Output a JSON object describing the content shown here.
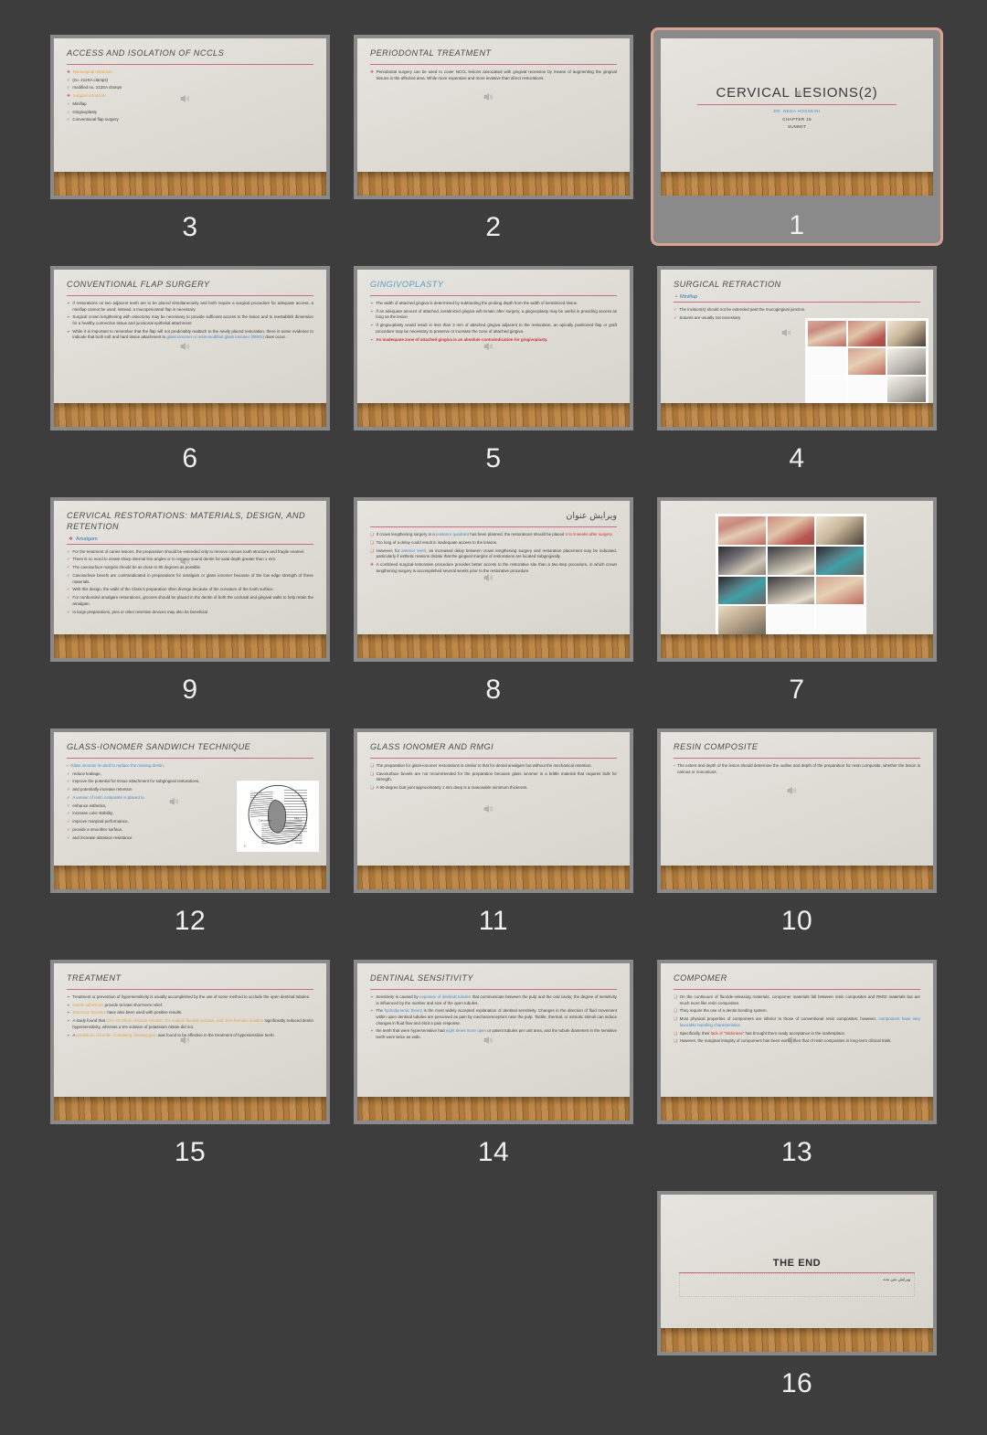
{
  "app": {
    "view": "slide-sorter",
    "background_color": "#3d3d3d",
    "selected_slide": 1,
    "accent_rule_color": "#d06a84",
    "selection_border_color": "#d9a38f",
    "speaker_icon": "audio-speaker-icon"
  },
  "slides": [
    {
      "number": "3",
      "title": "ACCESS AND ISOLATION OF NCCLS",
      "title_style": "italic",
      "has_audio": true,
      "bullets": [
        {
          "marker": "diamond",
          "text": "Nonsurgical retraction",
          "color": "orange"
        },
        {
          "marker": "check",
          "text": "(no. 212SA clamps)"
        },
        {
          "marker": "check",
          "text": "modified no. 212SA clamps"
        },
        {
          "marker": "diamond",
          "text": "Surgical retraction",
          "color": "orange"
        },
        {
          "marker": "check",
          "text": "Miniflap"
        },
        {
          "marker": "check",
          "text": "Gingivoplasty"
        },
        {
          "marker": "check",
          "text": "Conventional flap surgery"
        }
      ]
    },
    {
      "number": "2",
      "title": "PERIODONTAL TREATMENT",
      "title_style": "italic",
      "has_audio": true,
      "bullets": [
        {
          "marker": "diamond",
          "text": "Periodontal surgery can be used to cover NCCL lesions associated with gingival recession by means of augmenting the gingival tissues in the affected area. While more expensive and more invasive than direct restorations."
        }
      ]
    },
    {
      "number": "1",
      "selected": true,
      "layout": "title-slide",
      "title": "CERVICAL LESIONS(2)",
      "has_audio": true,
      "subtitles": [
        {
          "text": "DR. NEDA HOSSEINI",
          "color": "#4a86c5"
        },
        {
          "text": "CHAPTER 15",
          "color": "#3c3c3c"
        },
        {
          "text": "SUMMIT",
          "color": "#3c3c3c"
        }
      ]
    },
    {
      "number": "6",
      "title": "CONVENTIONAL FLAP SURGERY",
      "title_style": "italic",
      "has_audio": true,
      "bullets": [
        {
          "marker": "arrow",
          "text": "If restorations on two adjacent teeth are to be placed simultaneously and both require a surgical procedure for adequate access, a miniflap cannot be used; instead, a mucoperiosteal flap is necessary."
        },
        {
          "marker": "arrow",
          "text": "Surgical crown lengthening with ostectomy may be necessary to provide sufficient access to the lesion and to reestablish dimension for a healthy connective tissue and junctional epithelial attachment"
        },
        {
          "marker": "arrow",
          "text": "While it is important to remember that the flap will not predictably reattach to the newly placed restoration, there is some evidence to indicate that both soft and hard tissue attachment to ",
          "highlight": "glass ionomer or resin-modified glass ionomer (RMGI)",
          "highlight_color": "blue",
          "tail": " does occur."
        }
      ]
    },
    {
      "number": "5",
      "title": "GINGIVOPLASTY",
      "title_style": "italic-blue",
      "has_audio": true,
      "bullets": [
        {
          "marker": "arrow",
          "text": "The width of attached gingiva is determined by subtracting the probing depth from the width of keratinized tissue."
        },
        {
          "marker": "arrow",
          "text": "If an adequate amount of attached, keratinized gingiva will remain after surgery, a gingivoplasty may be useful in providing access as long as the lesion"
        },
        {
          "marker": "arrow",
          "text": "If gingivoplasty would result in less than 3 mm of attached gingiva adjacent to the restoration, an apically positioned flap or graft procedure may be necessary to preserve or increase the zone of attached gingiva."
        },
        {
          "marker": "arrow",
          "text": "An inadequate zone of attached gingiva is an absolute contraindication for gingivoplasty.",
          "all_red": true
        }
      ]
    },
    {
      "number": "4",
      "title": "SURGICAL RETRACTION",
      "title_style": "italic",
      "has_audio": true,
      "preline": {
        "text": "Miniflap",
        "bullet": "•",
        "color": "blue"
      },
      "bullets": [
        {
          "marker": "check",
          "text": "The incision(s) should not be extended past the mucogingival junction."
        },
        {
          "marker": "check",
          "text": "Sutures are usually not necessary"
        }
      ],
      "image_grid": {
        "name": "clinical-photo-grid",
        "columns": 3,
        "rows": 3,
        "cells": 9
      }
    },
    {
      "number": "9",
      "title": "CERVICAL RESTORATIONS: MATERIALS, DESIGN, AND RETENTION",
      "title_style": "italic",
      "has_audio": true,
      "preline": {
        "text": "Amalgam",
        "bullet": "❖",
        "color": "blue"
      },
      "bullets": [
        {
          "marker": "check",
          "text": "For the treatment of caries lesions, the preparation should be extended only to remove carious tooth structure and fragile enamel."
        },
        {
          "marker": "check",
          "text": "There is no need to create sharp internal line angles or to remove sound dentin for axial depth greater than 1 mm."
        },
        {
          "marker": "check",
          "text": "The cavosurface margins should be as close to 90 degrees as possible."
        },
        {
          "marker": "check",
          "text": "Cavosurface bevels are contraindicated in preparations for amalgam or glass ionomer because of the low edge strength of these materials."
        },
        {
          "marker": "check",
          "text": "With this design, the walls of the Class 5 preparation often diverge because of the curvature of the tooth surface."
        },
        {
          "marker": "check",
          "text": "For nonbonded amalgam restorations, grooves should be placed in the dentin of both the occlusal and gingival walls to help retain the amalgam."
        },
        {
          "marker": "check",
          "text": "In large preparations, pins or other retentive devices may also be beneficial"
        }
      ]
    },
    {
      "number": "8",
      "title": "ویرایش عنوان",
      "title_style": "rtl",
      "has_audio": true,
      "bullets": [
        {
          "marker": "box",
          "text": "If crown lengthening surgery in a ",
          "highlight": "posterior quadrant",
          "highlight_color": "blue",
          "tail": " has been planned, the restorations should be placed ",
          "highlight2": "4 to 8 weeks after surgery.",
          "highlight2_color": "red"
        },
        {
          "marker": "box",
          "text": "Too long of a delay could result in inadequate access to the lesions."
        },
        {
          "marker": "box",
          "text": "However, for ",
          "highlight": "anterior teeth",
          "highlight_color": "blue",
          "tail": ", an increased delay between crown lengthening surgery and restoration placement may be indicated, particularly if esthetic reasons dictate that the gingival margins of restorations are located subgingivally."
        },
        {
          "marker": "diamond",
          "text": "A combined surgical-restorative procedure provides better access to the restorative site than a two-step procedure, in which crown lengthening surgery is accomplished several weeks prior to the restorative procedure"
        }
      ]
    },
    {
      "number": "7",
      "layout": "image-only",
      "title": "",
      "has_audio": false,
      "image_grid": {
        "name": "clinical-photo-grid",
        "columns": 3,
        "rows": 4,
        "cells": 10
      }
    },
    {
      "number": "12",
      "title": "GLASS-IONOMER SANDWICH TECHNIQUE",
      "title_style": "italic",
      "has_audio": true,
      "bullets": [
        {
          "marker": "dot",
          "text": "Glass ionomer is used to replace the missing dentin,",
          "color": "blue"
        },
        {
          "marker": "check",
          "text": "reduce leakage,"
        },
        {
          "marker": "check",
          "text": "improve the potential for tissue attachment for subgingival restorations,"
        },
        {
          "marker": "check",
          "text": "and potentially increase retention"
        },
        {
          "marker": "check",
          "text": "A veneer of resin composite is placed to",
          "color": "blue"
        },
        {
          "marker": "check",
          "text": "enhance esthetics,"
        },
        {
          "marker": "check",
          "text": "increase color stability,"
        },
        {
          "marker": "check",
          "text": "improve marginal performance,"
        },
        {
          "marker": "check",
          "text": "provide a smoother surface,"
        },
        {
          "marker": "check",
          "text": "and increase abrasion resistance"
        }
      ],
      "diagram": {
        "name": "sandwich-technique-diagram",
        "labels": [
          "Composite",
          "RMGI"
        ]
      }
    },
    {
      "number": "11",
      "title": "GLASS IONOMER AND RMGI",
      "title_style": "italic",
      "has_audio": true,
      "bullets": [
        {
          "marker": "box",
          "text": "The preparation for glass-ionomer restorations is similar to that for dental amalgam but without the mechanical retention."
        },
        {
          "marker": "box",
          "text": "Cavosurface bevels are not recommended for the preparation because glass ionomer is a brittle material that requires bulk for strength."
        },
        {
          "marker": "box",
          "text": "A 90-degree butt joint approximately 1 mm deep is a reasonable minimum thickness."
        }
      ]
    },
    {
      "number": "10",
      "title": "RESIN COMPOSITE",
      "title_style": "italic",
      "has_audio": true,
      "bullets": [
        {
          "marker": "dot",
          "text": "The extent and depth of the lesion should determine the outline and depth of the preparation for resin composite, whether the lesion is carious or noncarious."
        }
      ]
    },
    {
      "number": "15",
      "title": "TREATMENT",
      "title_style": "italic",
      "has_audio": true,
      "bullets": [
        {
          "marker": "arrow",
          "text": "Treatment or prevention of hypersensitivity is usually accomplished by the use of some method to occlude the open dentinal tubules."
        },
        {
          "marker": "arrow",
          "text": "",
          "highlight": "Dentin adhesives",
          "highlight_color": "orange",
          "tail": " provide at least short-term relief."
        },
        {
          "marker": "arrow",
          "text": "",
          "highlight": "Stannous fluorides",
          "highlight_color": "orange",
          "tail": " have also been used with positive results."
        },
        {
          "marker": "arrow",
          "text": "A study found that ",
          "highlight": "10% strontium chloride solution, 2% sodium fluoride solution, and 40% formalin solution",
          "highlight_color": "orange",
          "tail": " significantly reduced dentin hypersensitivity, whereas a 5% solution of potassium nitrate did not."
        },
        {
          "marker": "arrow",
          "text": "A ",
          "highlight": "potassium chloride– containing chewing gum",
          "highlight_color": "orange",
          "tail": " was found to be effective in the treatment of hypersensitive teeth."
        }
      ]
    },
    {
      "number": "14",
      "title": "DENTINAL SENSITIVITY",
      "title_style": "italic",
      "has_audio": true,
      "bullets": [
        {
          "marker": "arrow",
          "text": "Sensitivity is caused by ",
          "highlight": "exposure of dentinal tubules",
          "highlight_color": "blue",
          "tail": " that communicate between the pulp and the oral cavity; the degree of sensitivity is influenced by the number and size of the open tubules."
        },
        {
          "marker": "arrow",
          "text": "The ",
          "highlight": "hydrodynamic theory",
          "highlight_color": "blue",
          "tail": " is the most widely accepted explanation of dentinal sensitivity. Changes in the direction of fluid movement within open dentinal tubules are perceived as pain by mechanoreceptors near the pulp. Tactile, thermal, or osmotic stimuli can induce changes in fluid flow and elicit a pain response."
        },
        {
          "marker": "arrow",
          "text": "the teeth that were hypersensitive had ",
          "highlight": "eight times more open",
          "highlight_color": "blue",
          "tail": " or patent tubules per unit area, and the tubule diameters in the sensitive teeth were twice as wide."
        }
      ]
    },
    {
      "number": "13",
      "title": "COMPOMER",
      "title_style": "italic",
      "has_audio": true,
      "bullets": [
        {
          "marker": "box",
          "text": "On the continuum of fluoride-releasing materials, compomer materials fall between resin composites and RMGI materials but are much more like resin composites."
        },
        {
          "marker": "box",
          "text": "They require the use of a dentin bonding system."
        },
        {
          "marker": "box",
          "text": "Most physical properties of compomers are inferior to those of conventional resin composites; however, ",
          "highlight": "compomers have very favorable handling characteristics.",
          "highlight_color": "blue"
        },
        {
          "marker": "box",
          "text": "Specifically, their ",
          "highlight": "lack of \"stickiness\"",
          "highlight_color": "red",
          "tail": " has brought them ready acceptance in the marketplace."
        },
        {
          "marker": "box",
          "text": "However, the marginal integrity of compomers has been worse then that of resin composites in long-term clinical trials."
        }
      ]
    },
    {
      "number": "16",
      "layout": "end-slide",
      "title": "THE END",
      "has_audio": false,
      "body_text": "ویرایش متن بدنه"
    }
  ]
}
